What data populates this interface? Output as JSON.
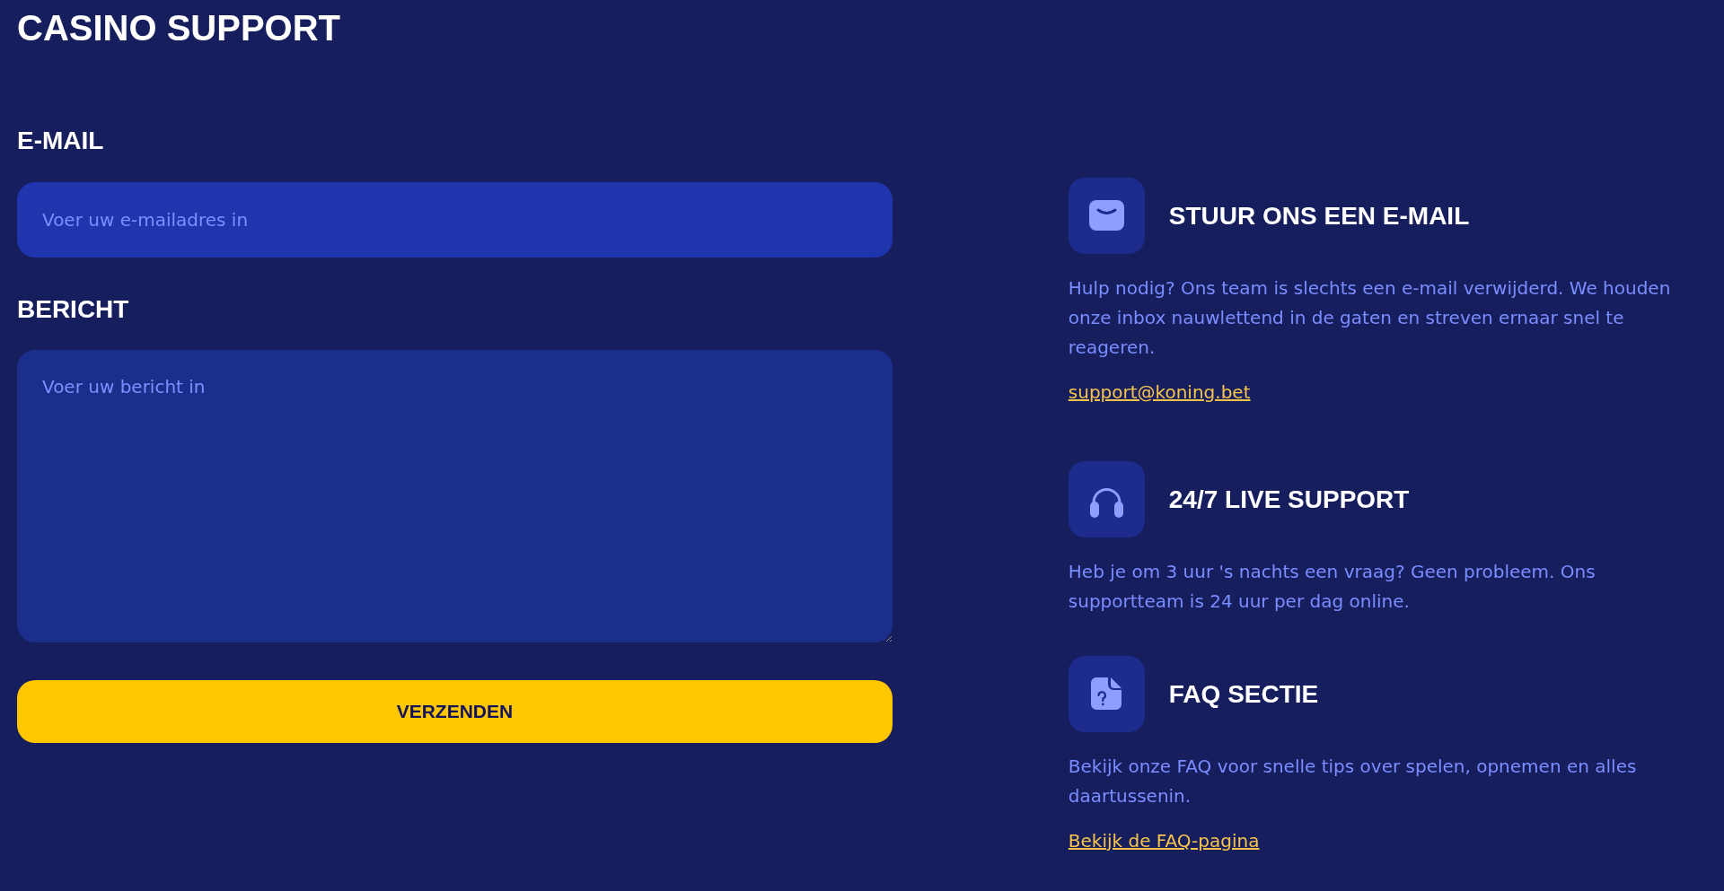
{
  "title": "CASINO SUPPORT",
  "form": {
    "fields": [
      {
        "kind": "input",
        "label": "E-MAIL",
        "placeholder": "Voer uw e-mailadres in"
      },
      {
        "kind": "textarea",
        "label": "BERICHT",
        "placeholder": "Voer uw bericht in"
      }
    ],
    "submit_button": "VERZENDEN"
  },
  "contact_options": [
    {
      "kind": "email",
      "heading": "STUUR ONS EEN E-MAIL",
      "text": "Hulp nodig? Ons team is slechts een e-mail verwijderd. We houden onze inbox nauwlettend in de gaten en streven ernaar snel te reageren.",
      "link": "support@koning.bet"
    },
    {
      "kind": "chat",
      "heading": "24/7 LIVE SUPPORT",
      "text": "Heb je om 3 uur 's nachts een vraag? Geen probleem. Ons supportteam is 24 uur per dag online."
    },
    {
      "kind": "faq",
      "heading": "FAQ SECTIE",
      "text": "Bekijk onze FAQ voor snelle tips over spelen, opnemen en alles daartussenin.",
      "link": "Bekijk de FAQ-pagina"
    }
  ]
}
